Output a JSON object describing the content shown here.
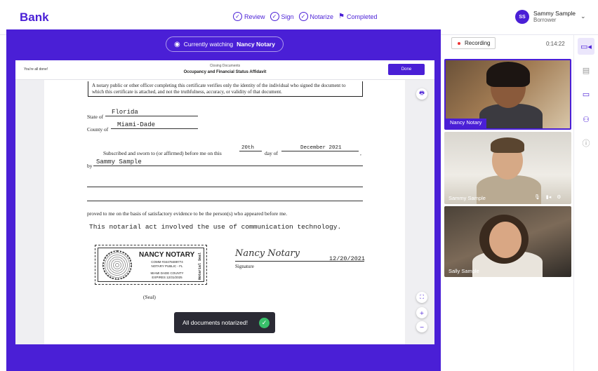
{
  "app": {
    "logo": "Bank"
  },
  "steps": [
    {
      "label": "Review",
      "icon": "check-circle-icon"
    },
    {
      "label": "Sign",
      "icon": "check-circle-icon"
    },
    {
      "label": "Notarize",
      "icon": "check-circle-icon"
    },
    {
      "label": "Completed",
      "icon": "flag-icon"
    }
  ],
  "user": {
    "initials": "SS",
    "name": "Sammy Sample",
    "role": "Borrower"
  },
  "stage": {
    "watch_prefix": "Currently watching",
    "watch_name": "Nancy Notary",
    "accent": "#4a1fd6"
  },
  "document": {
    "status_msg": "You're all done!",
    "subtitle": "Closing Documents",
    "title": "Occupancy and Financial Status Affidavit",
    "done_label": "Done",
    "cert_text": "A notary public or other officer completing this certificate verifies only the identity of the individual who signed the document to which this certificate is attached, and not the truthfulness, accuracy, or validity of that document.",
    "state_label": "State of",
    "state_value": "Florida",
    "county_label": "County of",
    "county_value": "Miami-Dade",
    "sworn_text": "Subscribed and sworn to (or affirmed) before me on this",
    "day_value": "20th",
    "day_of": "day of",
    "month_year": "December 2021",
    "by_label": "by",
    "by_value": "Sammy Sample",
    "proved_text": "proved to me on the basis of satisfactory evidence to be the person(s) who appeared before me.",
    "tech_stmt": "This notarial act involved the use of communication technology.",
    "seal": {
      "name": "NANCY NOTARY",
      "comm": "COMM #34478489774",
      "title": "NOTARY PUBLIC - FL",
      "county": "MIAMI DADE COUNTY",
      "expires": "EXPIRES 12/31/2025",
      "vertical": "Notarial Seal"
    },
    "signature_name": "Nancy Notary",
    "signature_date": "12/20/2021",
    "signature_label": "Signature",
    "seal_label": "(Seal)"
  },
  "toast": {
    "message": "All documents notarized!"
  },
  "recording": {
    "label": "Recording",
    "time": "0:14:22"
  },
  "participants": [
    {
      "name": "Nancy Notary"
    },
    {
      "name": "Sammy Sample"
    },
    {
      "name": "Sally Sample"
    }
  ]
}
